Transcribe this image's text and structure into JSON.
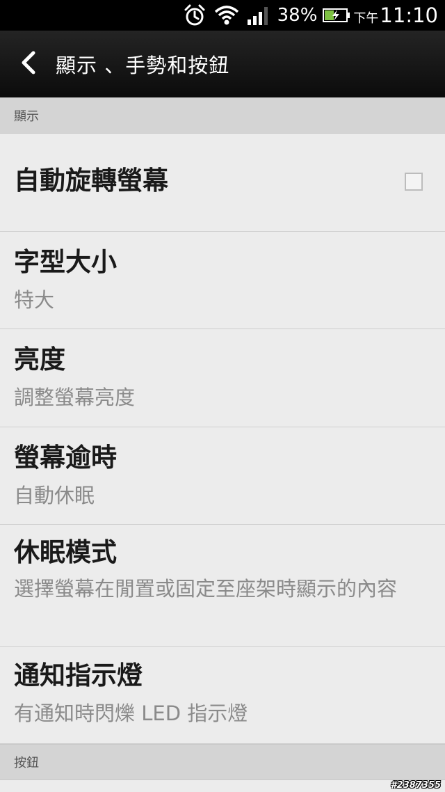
{
  "status_bar": {
    "battery_percent": "38%",
    "ampm": "下午",
    "time": "11:10",
    "icons": [
      "alarm-icon",
      "wifi-icon",
      "signal-icon",
      "battery-charging-icon"
    ]
  },
  "header": {
    "back_icon": "chevron-left-icon",
    "title": "顯示 、手勢和按鈕"
  },
  "sections": {
    "display": {
      "label": "顯示"
    },
    "buttons": {
      "label": "按鈕"
    }
  },
  "settings": {
    "auto_rotate": {
      "title": "自動旋轉螢幕",
      "checked": false
    },
    "font_size": {
      "title": "字型大小",
      "subtitle": "特大"
    },
    "brightness": {
      "title": "亮度",
      "subtitle": "調整螢幕亮度"
    },
    "screen_timeout": {
      "title": "螢幕逾時",
      "subtitle": "自動休眠"
    },
    "sleep_mode": {
      "title": "休眠模式",
      "subtitle": "選擇螢幕在閒置或固定至座架時顯示的內容"
    },
    "notification_light": {
      "title": "通知指示燈",
      "subtitle": "有通知時閃爍 LED 指示燈"
    }
  },
  "watermark": "#2387355"
}
